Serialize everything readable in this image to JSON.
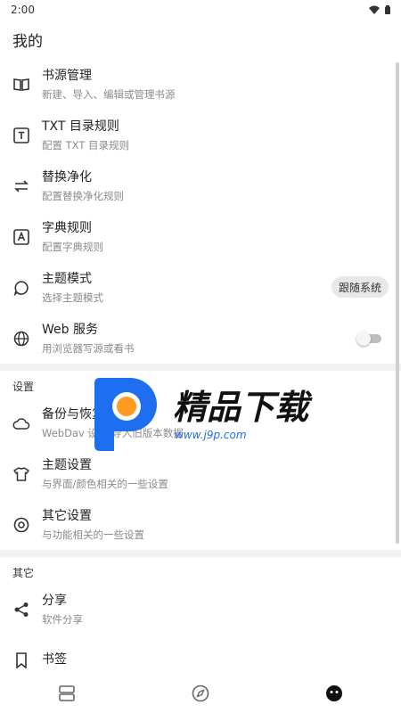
{
  "status_bar": {
    "time": "2:00",
    "icons": [
      "wifi-icon",
      "battery-icon"
    ]
  },
  "page_title": "我的",
  "sections": [
    {
      "items": [
        {
          "icon": "book-open-icon",
          "title": "书源管理",
          "summary": "新建、导入、编辑或管理书源"
        },
        {
          "icon": "txt-box-icon",
          "title": "TXT 目录规则",
          "summary": "配置 TXT 目录规则"
        },
        {
          "icon": "swap-arrows-icon",
          "title": "替换净化",
          "summary": "配置替换净化规则"
        },
        {
          "icon": "dictionary-icon",
          "title": "字典规则",
          "summary": "配置字典规则"
        },
        {
          "icon": "speech-bubble-icon",
          "title": "主题模式",
          "summary": "选择主题模式",
          "chip": "跟随系统"
        },
        {
          "icon": "globe-icon",
          "title": "Web 服务",
          "summary": "用浏览器写源或看书",
          "switch": false
        }
      ]
    },
    {
      "header": "设置",
      "items": [
        {
          "icon": "cloud-icon",
          "title": "备份与恢复",
          "summary": "WebDav 设置/导入旧版本数据"
        },
        {
          "icon": "tshirt-icon",
          "title": "主题设置",
          "summary": "与界面/颜色相关的一些设置"
        },
        {
          "icon": "settings-circle-icon",
          "title": "其它设置",
          "summary": "与功能相关的一些设置"
        }
      ]
    },
    {
      "header": "其它",
      "items": [
        {
          "icon": "share-icon",
          "title": "分享",
          "summary": "软件分享"
        },
        {
          "icon": "bookmark-icon",
          "title": "书签",
          "summary": ""
        }
      ]
    }
  ],
  "watermark": {
    "brand": "精品下载",
    "url": "www.j9p.com"
  },
  "bottom_nav": [
    {
      "icon": "bookshelf-icon",
      "active": false
    },
    {
      "icon": "compass-icon",
      "active": false
    },
    {
      "icon": "face-icon",
      "active": true
    }
  ],
  "colors": {
    "accent_blue": "#1e6ff0",
    "accent_orange": "#ff9a1f",
    "chip_bg": "#e8e8e8",
    "summary_text": "#8a8a8a"
  }
}
